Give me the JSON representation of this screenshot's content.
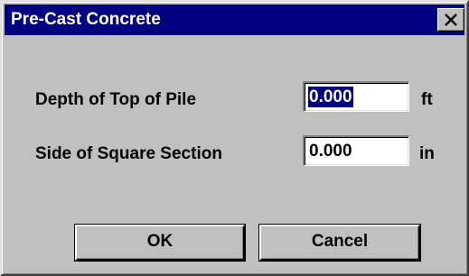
{
  "window": {
    "title": "Pre-Cast Concrete",
    "close_icon": "close-icon"
  },
  "fields": [
    {
      "label": "Depth of Top of Pile",
      "value": "0.000",
      "unit": "ft",
      "selected": true
    },
    {
      "label": "Side of Square Section",
      "value": "0.000",
      "unit": "in",
      "selected": false
    }
  ],
  "buttons": {
    "ok_label": "OK",
    "cancel_label": "Cancel"
  },
  "colors": {
    "titlebar": "#000080",
    "face": "#c0c0c0",
    "selection": "#000080"
  }
}
